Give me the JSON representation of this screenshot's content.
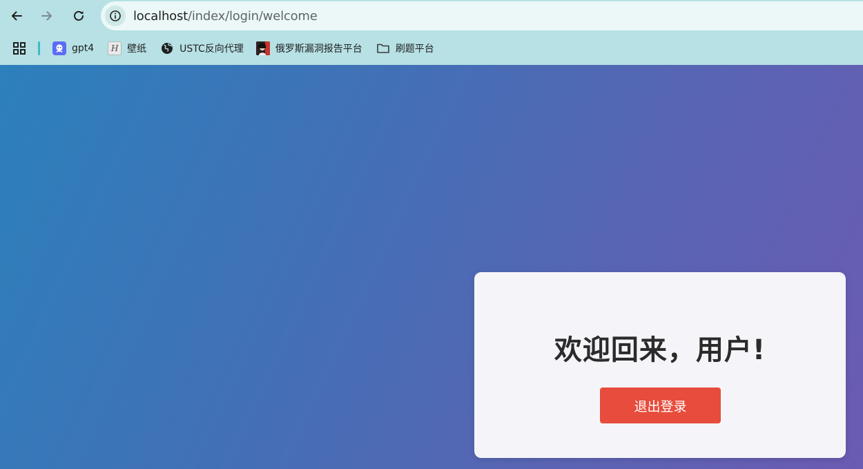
{
  "browser": {
    "nav": {
      "back_icon": "arrow-left-icon",
      "forward_icon": "arrow-right-icon",
      "reload_icon": "reload-icon"
    },
    "address_bar": {
      "site_info_icon": "info-icon",
      "host": "localhost",
      "path": "/index/login/welcome"
    },
    "bookmarks": {
      "apps_icon": "apps-grid-icon",
      "items": [
        {
          "label": "gpt4",
          "icon": "gpt-robot-icon"
        },
        {
          "label": "壁纸",
          "icon": "wallpaper-h-icon",
          "icon_glyph": "H"
        },
        {
          "label": "USTC反向代理",
          "icon": "globe-icon"
        },
        {
          "label": "俄罗斯漏洞报告平台",
          "icon": "avatar-favicon-icon"
        },
        {
          "label": "刷题平台",
          "icon": "folder-icon"
        }
      ]
    }
  },
  "page": {
    "welcome_title": "欢迎回来，用户!",
    "logout_label": "退出登录"
  },
  "colors": {
    "browser_chrome": "#b7e1e4",
    "omnibox": "#ecf8f8",
    "gradient_start": "#2c80bc",
    "gradient_end": "#6b5bb2",
    "card_background": "#f5f5f9",
    "logout_button": "#e74c3c",
    "title_text": "#2b2b2b"
  }
}
